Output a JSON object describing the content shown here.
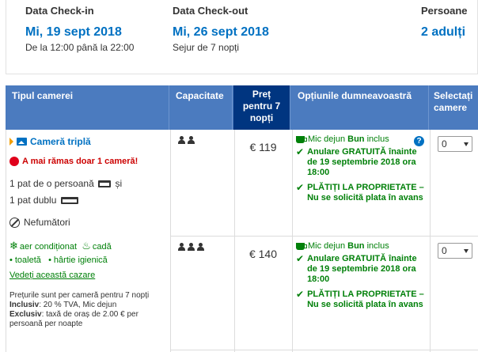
{
  "summary": {
    "checkin": {
      "label": "Data Check-in",
      "date": "Mi, 19 sept 2018",
      "sub": "De la 12:00 până la 22:00"
    },
    "checkout": {
      "label": "Data Check-out",
      "date": "Mi, 26 sept 2018",
      "sub": "Sejur de 7 nopți"
    },
    "persons": {
      "label": "Persoane",
      "value": "2 adulți"
    }
  },
  "table": {
    "headers": {
      "room_type": "Tipul camerei",
      "capacity": "Capacitate",
      "price": "Preț pentru 7 nopți",
      "options": "Opțiunile dumneavoastră",
      "select": "Selectați camere"
    },
    "room": {
      "name": "Cameră triplă",
      "alert": "A mai rămas doar 1 cameră!",
      "bed1": "1 pat de o persoană",
      "bed_join": "și",
      "bed2": "1 pat dublu",
      "smoking": "Nefumători",
      "amenity1": "aer condiționat",
      "amenity2": "cadă",
      "amenity3": "toaletă",
      "amenity4": "hârtie igienică",
      "link": "Vedeți această cazare",
      "note_line": "Prețurile sunt per cameră pentru 7 nopți",
      "note_incl_label": "Inclusiv",
      "note_incl": ": 20 % TVA, Mic dejun",
      "note_excl_label": "Exclusiv",
      "note_excl": ": taxă de oraș de 2.00 € per persoană per noapte"
    },
    "rows": [
      {
        "price": "€ 119",
        "breakfast_pre": "Mic dejun",
        "breakfast_bold": "Bun",
        "breakfast_post": "inclus",
        "cancel": "Anulare GRATUITĂ înainte de 19 septembrie 2018 ora 18:00",
        "pay": "PLĂTIȚI LA PROPRIETATE – Nu se solicită plata în avans",
        "select_value": "0"
      },
      {
        "price": "€ 140",
        "breakfast_pre": "Mic dejun",
        "breakfast_bold": "Bun",
        "breakfast_post": "inclus",
        "cancel": "Anulare GRATUITĂ înainte de 19 septembrie 2018 ora 18:00",
        "pay": "PLĂTIȚI LA PROPRIETATE – Nu se solicită plata în avans",
        "select_value": "0"
      }
    ]
  },
  "colors": {
    "link_blue": "#0071c2",
    "header_blue": "#4b7bbf",
    "price_header": "#003580",
    "green": "#008009",
    "alert_red": "#e0001b"
  }
}
